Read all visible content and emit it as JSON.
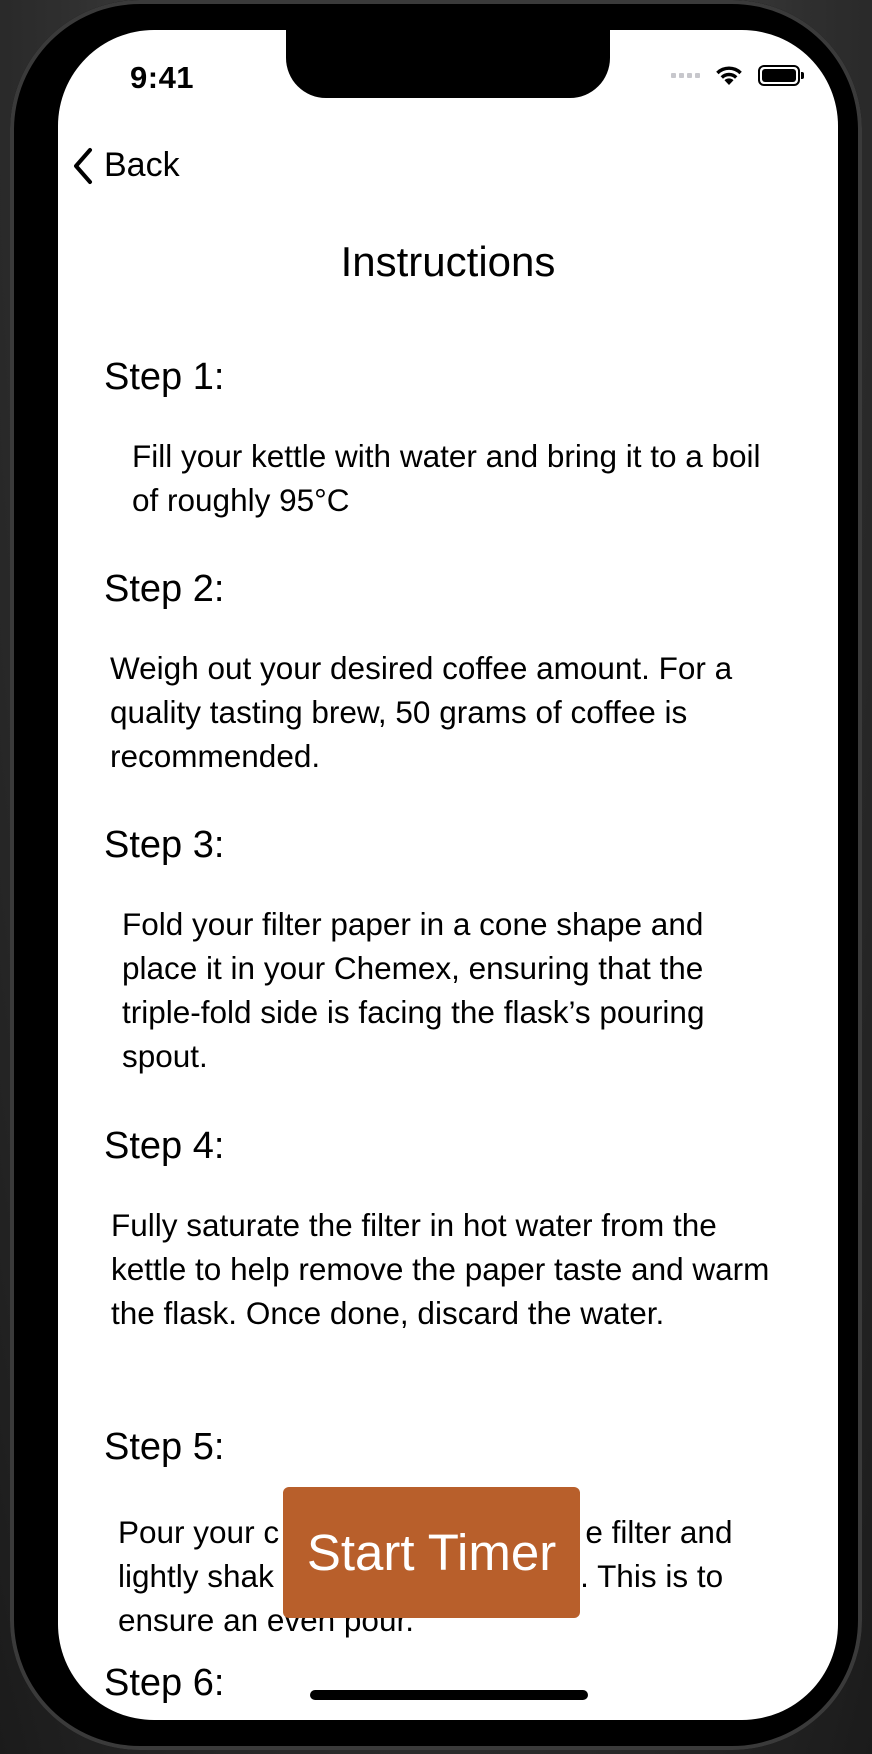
{
  "status_bar": {
    "time": "9:41"
  },
  "nav": {
    "back_label": "Back"
  },
  "page": {
    "title": "Instructions"
  },
  "steps": [
    {
      "heading": "Step 1:",
      "body": "Fill your kettle with water and bring it to a boil of roughly 95°C"
    },
    {
      "heading": "Step 2:",
      "body": "Weigh out your desired coffee amount. For a quality tasting brew, 50 grams of coffee is recommended."
    },
    {
      "heading": "Step 3:",
      "body": "Fold your filter paper in a cone shape and place it in your Chemex, ensuring that the triple-fold side is facing the flask’s pouring spout."
    },
    {
      "heading": "Step 4:",
      "body": "Fully saturate the filter in hot water from the kettle to help remove the paper taste and warm the flask. Once done, discard the water."
    },
    {
      "heading": "Step 5:",
      "body": "Pour your c                                   e filter and lightly shak                                   . This is to ensure an even pour."
    },
    {
      "heading": "Step 6:"
    }
  ],
  "timer_button": {
    "label": "Start Timer",
    "color": "#b85f2b"
  }
}
